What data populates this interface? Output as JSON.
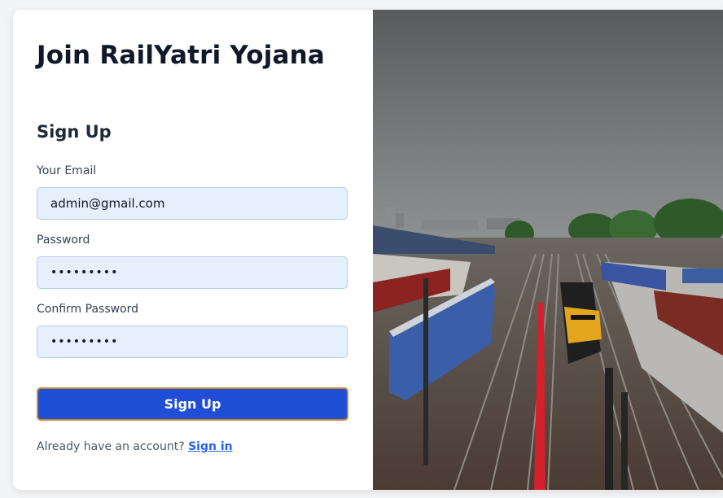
{
  "form": {
    "title": "Join RailYatri Yojana",
    "subtitle": "Sign Up",
    "email": {
      "label": "Your Email",
      "value": "admin@gmail.com"
    },
    "password": {
      "label": "Password",
      "value": "•••••••••"
    },
    "confirm_password": {
      "label": "Confirm Password",
      "value": "•••••••••"
    },
    "submit_label": "Sign Up",
    "footer_text": "Already have an account?",
    "footer_link": "Sign in"
  },
  "colors": {
    "primary_button": "#1f4fd6",
    "input_bg": "#e6effc",
    "link": "#2563eb"
  }
}
